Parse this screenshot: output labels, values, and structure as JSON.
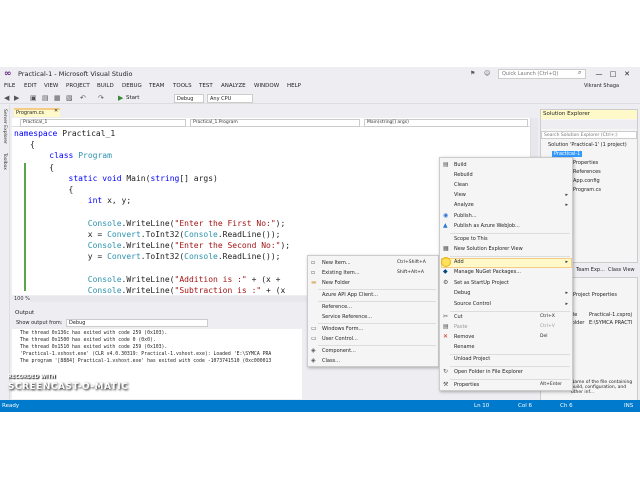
{
  "window": {
    "title": "Practical-1 - Microsoft Visual Studio",
    "quick_launch_placeholder": "Quick Launch (Ctrl+Q)",
    "user": "Vikrant Shaga",
    "minimize": "—",
    "maximize": "□",
    "close": "✕"
  },
  "menu": [
    "FILE",
    "EDIT",
    "VIEW",
    "PROJECT",
    "BUILD",
    "DEBUG",
    "TEAM",
    "TOOLS",
    "TEST",
    "ANALYZE",
    "WINDOW",
    "HELP"
  ],
  "toolbar": {
    "start_label": "Start",
    "config_value": "Debug",
    "platform_value": "Any CPU"
  },
  "left_strip": {
    "server_explorer": "Server Explorer",
    "toolbox": "Toolbox"
  },
  "editor": {
    "tab_label": "Program.cs",
    "nav_project": "Practical_1",
    "nav_class": "Practical_1.Program",
    "nav_member": "Main(string[] args)",
    "zoom": "100 %",
    "code": [
      "namespace Practical_1",
      "{",
      "    class Program",
      "    {",
      "        static void Main(string[] args)",
      "        {",
      "            int x, y;",
      "",
      "            Console.WriteLine(\"Enter the First No:\");",
      "            x = Convert.ToInt32(Console.ReadLine());",
      "            Console.WriteLine(\"Enter the Second No:\");",
      "            y = Convert.ToInt32(Console.ReadLine());",
      "",
      "            Console.WriteLine(\"Addition is :\" + (x +",
      "            Console.WriteLine(\"Subtraction is :\" + (x"
    ]
  },
  "output": {
    "title": "Output",
    "show_from_label": "Show output from:",
    "show_from_value": "Debug",
    "lines": [
      "The thread 0x136c has exited with code 259 (0x103).",
      "The thread 0x1500 has exited with code 0 (0x0).",
      "The thread 0x1510 has exited with code 259 (0x103).",
      "'Practical-1.vshost.exe' (CLR v4.0.30319: Practical-1.vshost.exe): Loaded 'E:\\SYMCA PRA",
      "The program '[8884] Practical-1.vshost.exe' has exited with code -1073741510 (0xc000013"
    ]
  },
  "solution_explorer": {
    "title": "Solution Explorer",
    "search_placeholder": "Search Solution Explorer (Ctrl+;)",
    "items": [
      "Solution 'Practical-1' (1 project)",
      "Practical-1",
      "Properties",
      "References",
      "App.config",
      "Program.cs"
    ],
    "tab_1": "Team Exp...",
    "tab_2": "Class View"
  },
  "properties": {
    "header": "Project Properties",
    "row1_label": "File",
    "row1_value": "Practical-1.csproj",
    "row2_label": "Folder",
    "row2_value": "E:\\SYMCA PRACTI",
    "desc": "Name of the file containing build, configuration, and other inf..."
  },
  "status": {
    "ready": "Ready",
    "ln": "Ln 10",
    "col": "Col 6",
    "ch": "Ch 6",
    "ins": "INS"
  },
  "context_menu": {
    "items": [
      {
        "label": "Build",
        "shortcut": "",
        "submenu": false,
        "disabled": false
      },
      {
        "label": "Rebuild",
        "shortcut": "",
        "submenu": false,
        "disabled": false
      },
      {
        "label": "Clean",
        "shortcut": "",
        "submenu": false,
        "disabled": false
      },
      {
        "label": "View",
        "shortcut": "",
        "submenu": true,
        "disabled": false
      },
      {
        "label": "Analyze",
        "shortcut": "",
        "submenu": true,
        "disabled": false
      },
      {
        "label": "Publish...",
        "shortcut": "",
        "submenu": false,
        "disabled": false
      },
      {
        "label": "Publish as Azure WebJob...",
        "shortcut": "",
        "submenu": false,
        "disabled": false
      },
      {
        "label": "Scope to This",
        "shortcut": "",
        "submenu": false,
        "disabled": false
      },
      {
        "label": "New Solution Explorer View",
        "shortcut": "",
        "submenu": false,
        "disabled": false
      },
      {
        "label": "Add",
        "shortcut": "",
        "submenu": true,
        "disabled": false
      },
      {
        "label": "Manage NuGet Packages...",
        "shortcut": "",
        "submenu": false,
        "disabled": false
      },
      {
        "label": "Set as StartUp Project",
        "shortcut": "",
        "submenu": false,
        "disabled": false
      },
      {
        "label": "Debug",
        "shortcut": "",
        "submenu": true,
        "disabled": false
      },
      {
        "label": "Source Control",
        "shortcut": "",
        "submenu": true,
        "disabled": false
      },
      {
        "label": "Cut",
        "shortcut": "Ctrl+X",
        "submenu": false,
        "disabled": false
      },
      {
        "label": "Paste",
        "shortcut": "Ctrl+V",
        "submenu": false,
        "disabled": true
      },
      {
        "label": "Remove",
        "shortcut": "Del",
        "submenu": false,
        "disabled": false
      },
      {
        "label": "Rename",
        "shortcut": "",
        "submenu": false,
        "disabled": false
      },
      {
        "label": "Unload Project",
        "shortcut": "",
        "submenu": false,
        "disabled": false
      },
      {
        "label": "Open Folder in File Explorer",
        "shortcut": "",
        "submenu": false,
        "disabled": false
      },
      {
        "label": "Properties",
        "shortcut": "Alt+Enter",
        "submenu": false,
        "disabled": false
      }
    ]
  },
  "add_submenu": {
    "items": [
      {
        "label": "New Item...",
        "shortcut": "Ctrl+Shift+A"
      },
      {
        "label": "Existing Item...",
        "shortcut": "Shift+Alt+A"
      },
      {
        "label": "New Folder",
        "shortcut": ""
      },
      {
        "label": "Azure API App Client...",
        "shortcut": ""
      },
      {
        "label": "Reference...",
        "shortcut": ""
      },
      {
        "label": "Service Reference...",
        "shortcut": ""
      },
      {
        "label": "Windows Form...",
        "shortcut": ""
      },
      {
        "label": "User Control...",
        "shortcut": ""
      },
      {
        "label": "Component...",
        "shortcut": ""
      },
      {
        "label": "Class...",
        "shortcut": ""
      }
    ]
  },
  "watermark": {
    "recorded_with": "RECORDED WITH",
    "brand": "SCREENCAST-O-MATIC"
  }
}
